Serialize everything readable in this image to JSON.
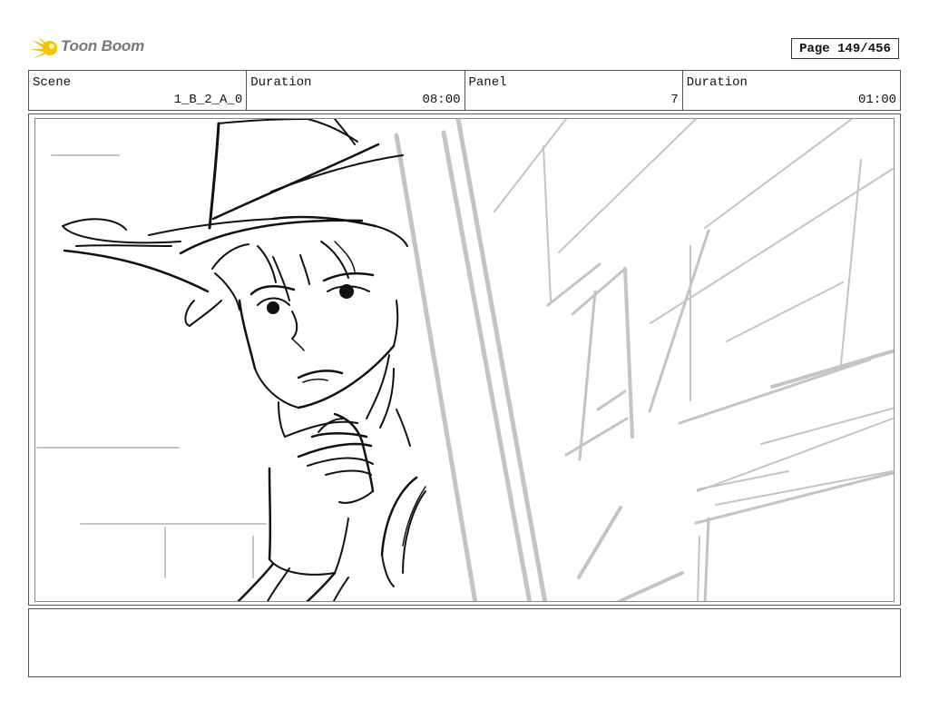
{
  "brand": {
    "name": "Toon Boom",
    "accent": "#f5c400"
  },
  "page": {
    "label": "Page 149/456"
  },
  "header": {
    "scene_label": "Scene",
    "scene_value": "1_B_2_A_0",
    "duration_label": "Duration",
    "duration_value": "08:00",
    "panel_label": "Panel",
    "panel_value": "7",
    "panel_duration_label": "Duration",
    "panel_duration_value": "01:00"
  },
  "notes": {
    "text": ""
  },
  "colors": {
    "ink": "#111111",
    "guide": "#c4c4c4",
    "border": "#555555"
  }
}
